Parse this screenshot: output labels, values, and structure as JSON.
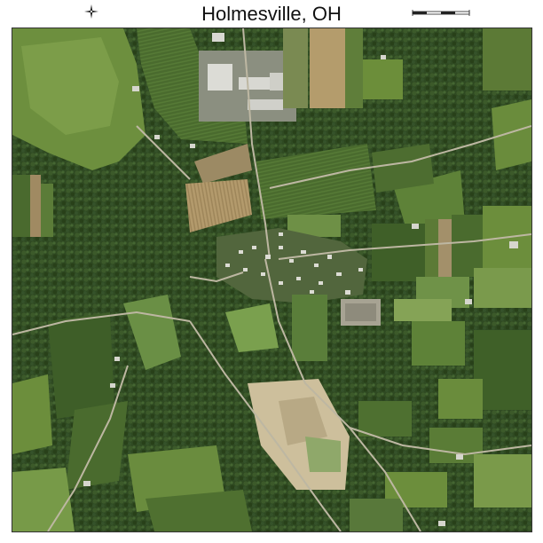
{
  "header": {
    "title": "Holmesville, OH"
  },
  "icons": {
    "compass": "north-arrow-icon",
    "scale": "scale-bar-icon"
  },
  "map": {
    "type": "aerial-photograph",
    "colors": {
      "forest": "#2f4a22",
      "field": "#5f7e3a",
      "light_field": "#83a152",
      "bare_soil": "#a08a62",
      "quarry": "#cdbf9c",
      "road": "#b9b3a0",
      "building": "#d8d8d2"
    }
  }
}
